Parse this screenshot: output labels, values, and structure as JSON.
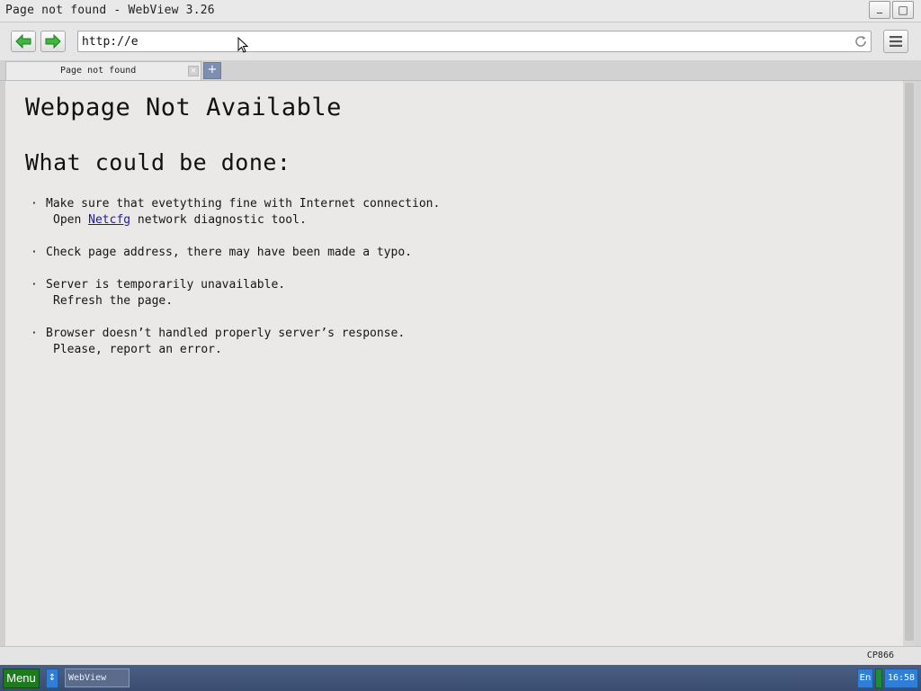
{
  "window": {
    "title": "Page not found - WebView 3.26",
    "minimize_glyph": "_",
    "maximize_glyph": "□"
  },
  "toolbar": {
    "back_icon": "green-arrow-left-icon",
    "forward_icon": "green-arrow-right-icon",
    "url": "http://e",
    "reload_icon": "reload-icon",
    "menu_icon": "hamburger-icon"
  },
  "tabs": [
    {
      "label": "Page not found",
      "close_glyph": "×"
    }
  ],
  "new_tab_glyph": "+",
  "page": {
    "heading": "Webpage Not Available",
    "subheading": "What could be done:",
    "bullet_glyph": "·",
    "tips": [
      {
        "line1": "Make sure that evetything fine with Internet connection.",
        "line2_before": "Open ",
        "line2_link": "Netcfg",
        "line2_after": " network diagnostic tool."
      },
      {
        "line1": "Check page address, there may have been made a typo.",
        "line2_before": "",
        "line2_link": "",
        "line2_after": ""
      },
      {
        "line1": "Server is temporarily unavailable.",
        "line2_before": "Refresh the page.",
        "line2_link": "",
        "line2_after": ""
      },
      {
        "line1": "Browser doesn’t handled properly server’s response.",
        "line2_before": "Please, report an error.",
        "line2_link": "",
        "line2_after": ""
      }
    ]
  },
  "statusbar": {
    "encoding": "CP866"
  },
  "taskbar": {
    "menu_label": "Menu",
    "switch_glyph": "↕",
    "task_item": "WebView",
    "language": "En",
    "clock": "16:58"
  },
  "colors": {
    "accent_green": "#1d7a1d",
    "accent_blue": "#2f7fd8",
    "link": "#1a1aa8",
    "taskbar": "#4a5f85"
  }
}
